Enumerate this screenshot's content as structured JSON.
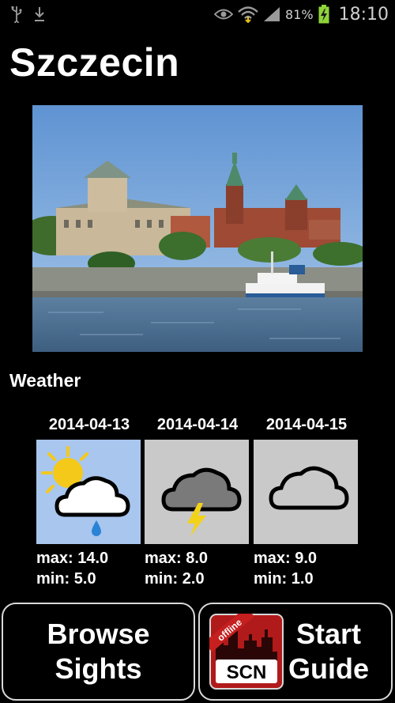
{
  "status_bar": {
    "battery_percent": "81%",
    "time": "18:10",
    "icons": [
      "usb-icon",
      "download-icon",
      "eye-icon",
      "wifi-icon",
      "signal-icon",
      "battery-charging-icon"
    ]
  },
  "page": {
    "title": "Szczecin"
  },
  "weather": {
    "heading": "Weather",
    "days": [
      {
        "date": "2014-04-13",
        "max": "max: 14.0",
        "min": "min: 5.0",
        "icon": "sun-cloud-rain-icon",
        "bg": "#a8c6ee"
      },
      {
        "date": "2014-04-14",
        "max": "max: 8.0",
        "min": "min: 2.0",
        "icon": "thunderstorm-icon",
        "bg": "#c9c9c9"
      },
      {
        "date": "2014-04-15",
        "max": "max: 9.0",
        "min": "min: 1.0",
        "icon": "cloud-icon",
        "bg": "#c9c9c9"
      }
    ]
  },
  "buttons": {
    "browse_line1": "Browse",
    "browse_line2": "Sights",
    "start_line1": "Start",
    "start_line2": "Guide"
  },
  "logo": {
    "ribbon": "offline",
    "text": "SCN"
  },
  "colors": {
    "background": "#000000",
    "logo_red": "#b11a1a",
    "lightning": "#f3d21a",
    "rain": "#2b83d6"
  }
}
